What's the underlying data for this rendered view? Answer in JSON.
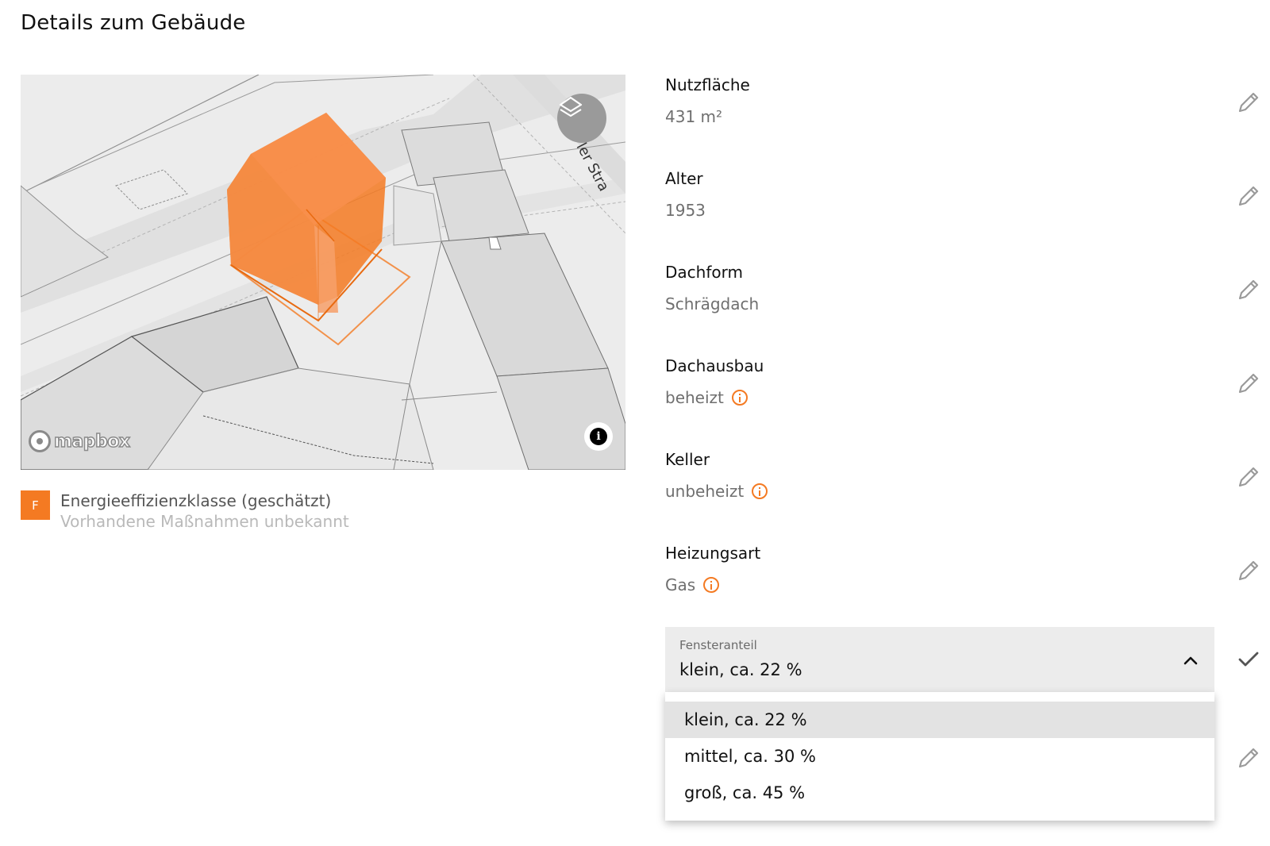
{
  "page": {
    "title": "Details zum Gebäude"
  },
  "map": {
    "street_label": "ler Stra",
    "attribution": "mapbox",
    "accent_color": "#f47a22"
  },
  "energy": {
    "class": "F",
    "label": "Energieeffizienzklasse (geschätzt)",
    "sublabel": "Vorhandene Maßnahmen unbekannt",
    "badge_color": "#f47a22"
  },
  "properties": [
    {
      "label": "Nutzfläche",
      "value": "431 m²",
      "info": false
    },
    {
      "label": "Alter",
      "value": "1953",
      "info": false
    },
    {
      "label": "Dachform",
      "value": "Schrägdach",
      "info": false
    },
    {
      "label": "Dachausbau",
      "value": "beheizt",
      "info": true
    },
    {
      "label": "Keller",
      "value": "unbeheizt",
      "info": true
    },
    {
      "label": "Heizungsart",
      "value": "Gas",
      "info": true
    }
  ],
  "fensteranteil": {
    "caption": "Fensteranteil",
    "selected": "klein, ca. 22 %",
    "options": [
      "klein, ca. 22 %",
      "mittel, ca. 30 %",
      "groß, ca. 45 %"
    ]
  },
  "icons": {
    "edit": "pencil-icon",
    "confirm": "check-icon",
    "info": "info-circle-icon",
    "layers": "layers-icon",
    "chevron": "chevron-up-icon"
  }
}
